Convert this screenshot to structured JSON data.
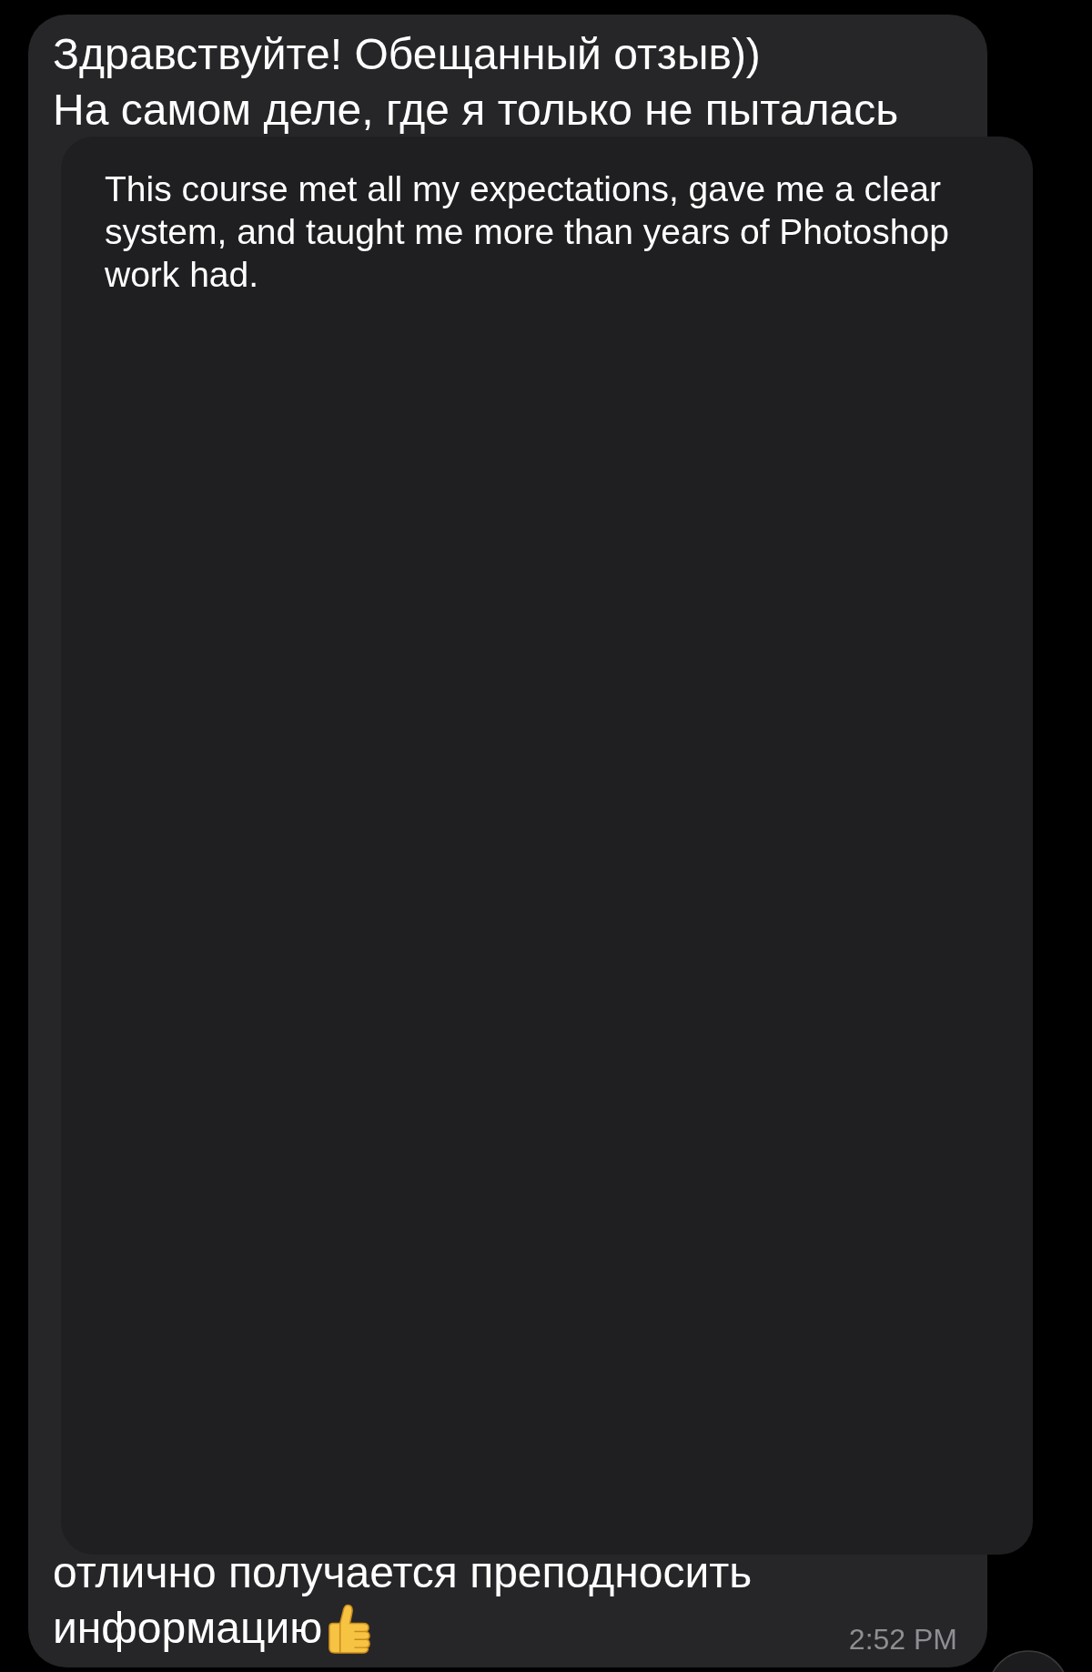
{
  "message": {
    "lines_top": [
      "Здравствуйте! Обещанный отзыв))",
      "На самом деле, где я только не пыталась"
    ],
    "lines_bottom": [
      "отлично получается преподносить",
      "информацию"
    ],
    "time": "2:52 PM"
  },
  "translation_popup": {
    "text": "This course met all my expectations, gave me a clear system, and taught me more than years of Photoshop work had."
  }
}
